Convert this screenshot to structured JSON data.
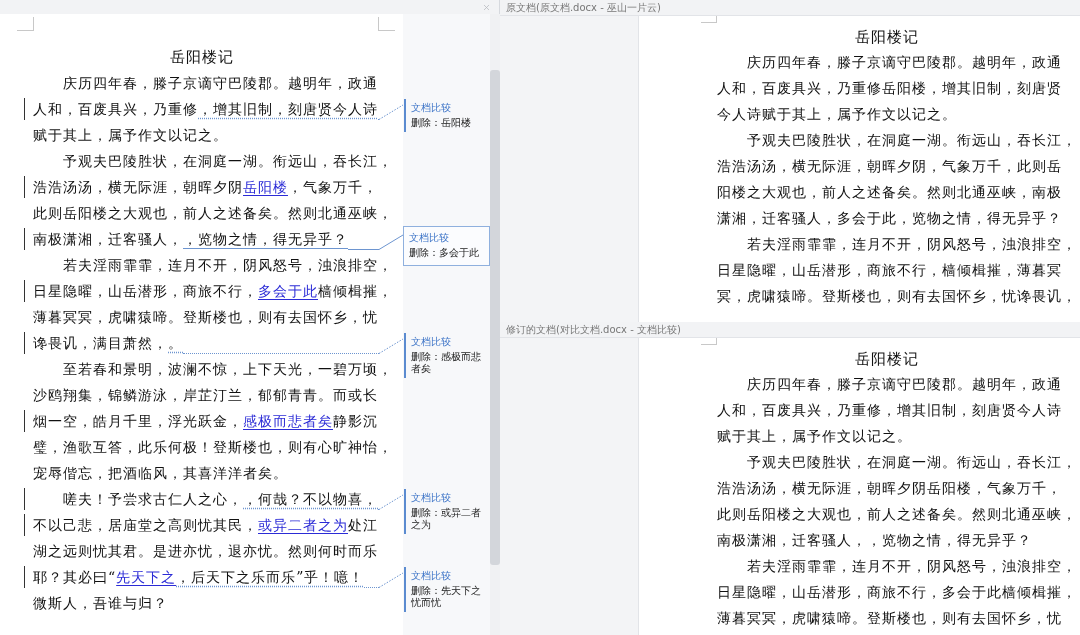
{
  "comparison_pane": {
    "title": "岳阳楼记",
    "lines": [
      {
        "paragraph_start": true,
        "changed": false,
        "segments": [
          {
            "kind": "plain",
            "text": "庆历四年春，滕子京谪守巴陵郡。越明年，政通"
          }
        ]
      },
      {
        "paragraph_start": false,
        "changed": true,
        "segments": [
          {
            "kind": "plain",
            "text": "人和，百废具兴，乃重修"
          },
          {
            "kind": "leader",
            "text": "，增其旧制，刻唐贤今人诗"
          }
        ],
        "balloon": {
          "title": "文档比较",
          "note": "删除：岳阳楼",
          "selected": false
        }
      },
      {
        "paragraph_start": false,
        "changed": false,
        "segments": [
          {
            "kind": "plain",
            "text": "赋于其上，属予作文以记之。"
          }
        ]
      },
      {
        "paragraph_start": true,
        "changed": false,
        "segments": [
          {
            "kind": "plain",
            "text": "予观夫巴陵胜状，在洞庭一湖。衔远山，吞长江，"
          }
        ]
      },
      {
        "paragraph_start": false,
        "changed": true,
        "segments": [
          {
            "kind": "plain",
            "text": "浩浩汤汤，横无际涯，朝晖夕阴"
          },
          {
            "kind": "inserted",
            "text": "岳阳楼"
          },
          {
            "kind": "plain",
            "text": "，气象万千，"
          }
        ]
      },
      {
        "paragraph_start": false,
        "changed": false,
        "segments": [
          {
            "kind": "plain",
            "text": "此则岳阳楼之大观也，前人之述备矣。然则北通巫峡，"
          }
        ]
      },
      {
        "paragraph_start": false,
        "changed": true,
        "segments": [
          {
            "kind": "plain",
            "text": "南极潇湘，迁客骚人，"
          },
          {
            "kind": "leader",
            "text": "，览物之情，得无异乎？"
          }
        ],
        "balloon": {
          "title": "文档比较",
          "note": "删除：多会于此",
          "selected": true
        }
      },
      {
        "paragraph_start": true,
        "changed": false,
        "segments": [
          {
            "kind": "plain",
            "text": "若夫淫雨霏霏，连月不开，阴风怒号，浊浪排空，"
          }
        ]
      },
      {
        "paragraph_start": false,
        "changed": true,
        "segments": [
          {
            "kind": "plain",
            "text": "日星隐曜，山岳潜形，商旅不行，"
          },
          {
            "kind": "inserted",
            "text": "多会于此"
          },
          {
            "kind": "plain",
            "text": "樯倾楫摧，"
          }
        ]
      },
      {
        "paragraph_start": false,
        "changed": false,
        "segments": [
          {
            "kind": "plain",
            "text": "薄暮冥冥，虎啸猿啼。登斯楼也，则有去国怀乡，忧"
          }
        ]
      },
      {
        "paragraph_start": false,
        "changed": true,
        "segments": [
          {
            "kind": "plain",
            "text": "谗畏讥，满目萧然，"
          },
          {
            "kind": "leader",
            "text": "。"
          }
        ],
        "balloon": {
          "title": "文档比较",
          "note": "删除：感极而悲者矣",
          "selected": false
        }
      },
      {
        "paragraph_start": true,
        "changed": false,
        "segments": [
          {
            "kind": "plain",
            "text": "至若春和景明，波澜不惊，上下天光，一碧万顷，"
          }
        ]
      },
      {
        "paragraph_start": false,
        "changed": false,
        "segments": [
          {
            "kind": "plain",
            "text": "沙鸥翔集，锦鳞游泳，岸芷汀兰，郁郁青青。而或长"
          }
        ]
      },
      {
        "paragraph_start": false,
        "changed": true,
        "segments": [
          {
            "kind": "plain",
            "text": "烟一空，皓月千里，浮光跃金，"
          },
          {
            "kind": "inserted",
            "text": "感极而悲者矣"
          },
          {
            "kind": "plain",
            "text": "静影沉"
          }
        ]
      },
      {
        "paragraph_start": false,
        "changed": false,
        "segments": [
          {
            "kind": "plain",
            "text": "璧，渔歌互答，此乐何极！登斯楼也，则有心旷神怡，"
          }
        ]
      },
      {
        "paragraph_start": false,
        "changed": false,
        "segments": [
          {
            "kind": "plain",
            "text": "宠辱偕忘，把酒临风，其喜洋洋者矣。"
          }
        ]
      },
      {
        "paragraph_start": true,
        "changed": true,
        "segments": [
          {
            "kind": "plain",
            "text": "嗟夫！予尝求古仁人之心，"
          },
          {
            "kind": "leader",
            "text": "，何哉？不以物喜，"
          }
        ],
        "balloon": {
          "title": "文档比较",
          "note": "删除：或异二者之为",
          "selected": false
        }
      },
      {
        "paragraph_start": false,
        "changed": true,
        "segments": [
          {
            "kind": "plain",
            "text": "不以己悲，居庙堂之高则忧其民，"
          },
          {
            "kind": "inserted",
            "text": "或异二者之为"
          },
          {
            "kind": "plain",
            "text": "处江"
          }
        ]
      },
      {
        "paragraph_start": false,
        "changed": false,
        "segments": [
          {
            "kind": "plain",
            "text": "湖之远则忧其君。是进亦忧，退亦忧。然则何时而乐"
          }
        ]
      },
      {
        "paragraph_start": false,
        "changed": true,
        "segments": [
          {
            "kind": "plain",
            "text": "耶？其必曰“"
          },
          {
            "kind": "inserted",
            "text": "先天下之"
          },
          {
            "kind": "leader",
            "text": "，后天下之乐而乐”乎！噫！"
          }
        ],
        "balloon": {
          "title": "文档比较",
          "note": "删除：先天下之忧而忧",
          "selected": false
        }
      },
      {
        "paragraph_start": false,
        "changed": false,
        "segments": [
          {
            "kind": "plain",
            "text": "微斯人，吾谁与归？"
          }
        ]
      }
    ]
  },
  "original_pane": {
    "header": "原文档(原文档.docx - 巫山一片云)",
    "title": "岳阳楼记",
    "lines": [
      {
        "paragraph_start": true,
        "text": "庆历四年春，滕子京谪守巴陵郡。越明年，政通"
      },
      {
        "paragraph_start": false,
        "text": "人和，百废具兴，乃重修岳阳楼，增其旧制，刻唐贤"
      },
      {
        "paragraph_start": false,
        "text": "今人诗赋于其上，属予作文以记之。"
      },
      {
        "paragraph_start": true,
        "text": "予观夫巴陵胜状，在洞庭一湖。衔远山，吞长江，"
      },
      {
        "paragraph_start": false,
        "text": "浩浩汤汤，横无际涯，朝晖夕阴，气象万千，此则岳"
      },
      {
        "paragraph_start": false,
        "text": "阳楼之大观也，前人之述备矣。然则北通巫峡，南极"
      },
      {
        "paragraph_start": false,
        "text": "潇湘，迁客骚人，多会于此，览物之情，得无异乎？"
      },
      {
        "paragraph_start": true,
        "text": "若夫淫雨霏霏，连月不开，阴风怒号，浊浪排空，"
      },
      {
        "paragraph_start": false,
        "text": "日星隐曜，山岳潜形，商旅不行，樯倾楫摧，薄暮冥"
      },
      {
        "paragraph_start": false,
        "text": "冥，虎啸猿啼。登斯楼也，则有去国怀乡，忧谗畏讥，"
      }
    ]
  },
  "revised_pane": {
    "header": "修订的文档(对比文档.docx - 文档比较)",
    "title": "岳阳楼记",
    "lines": [
      {
        "paragraph_start": true,
        "text": "庆历四年春，滕子京谪守巴陵郡。越明年，政通"
      },
      {
        "paragraph_start": false,
        "text": "人和，百废具兴，乃重修，增其旧制，刻唐贤今人诗"
      },
      {
        "paragraph_start": false,
        "text": "赋于其上，属予作文以记之。"
      },
      {
        "paragraph_start": true,
        "text": "予观夫巴陵胜状，在洞庭一湖。衔远山，吞长江，"
      },
      {
        "paragraph_start": false,
        "text": "浩浩汤汤，横无际涯，朝晖夕阴岳阳楼，气象万千，"
      },
      {
        "paragraph_start": false,
        "text": "此则岳阳楼之大观也，前人之述备矣。然则北通巫峡，"
      },
      {
        "paragraph_start": false,
        "text": "南极潇湘，迁客骚人，，览物之情，得无异乎？"
      },
      {
        "paragraph_start": true,
        "text": "若夫淫雨霏霏，连月不开，阴风怒号，浊浪排空，"
      },
      {
        "paragraph_start": false,
        "text": "日星隐曜，山岳潜形，商旅不行，多会于此樯倾楫摧，"
      },
      {
        "paragraph_start": false,
        "text": "薄暮冥冥，虎啸猿啼。登斯楼也，则有去国怀乡，忧"
      }
    ]
  }
}
